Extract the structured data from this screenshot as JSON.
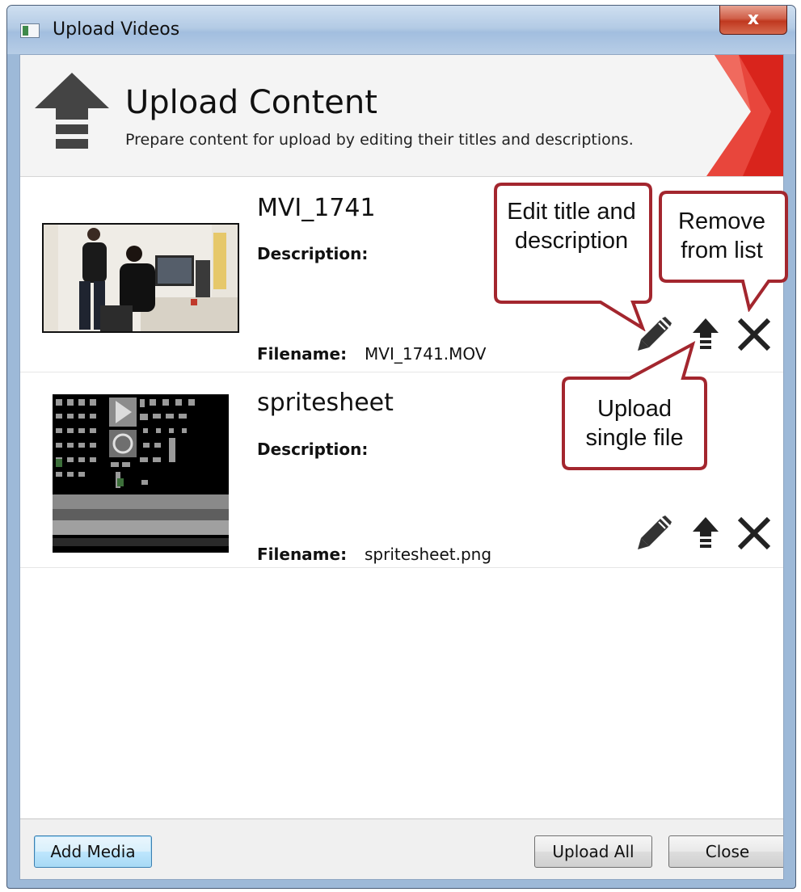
{
  "window": {
    "title": "Upload Videos",
    "close_glyph": "x"
  },
  "header": {
    "title": "Upload Content",
    "subtitle": "Prepare content for upload by editing their titles and descriptions.",
    "icon": "upload-arrow-icon",
    "accent_color": "#d9241c"
  },
  "items": [
    {
      "title": "MVI_1741",
      "description_label": "Description:",
      "description": "",
      "filename_label": "Filename:",
      "filename": "MVI_1741.MOV",
      "thumbnail": "office-photo"
    },
    {
      "title": "spritesheet",
      "description_label": "Description:",
      "description": "",
      "filename_label": "Filename:",
      "filename": "spritesheet.png",
      "thumbnail": "spritesheet-image"
    }
  ],
  "actions": {
    "edit": "pencil-icon",
    "upload": "upload-icon",
    "remove": "close-icon"
  },
  "callouts": {
    "edit": "Edit title and description",
    "remove": "Remove from list",
    "upload": "Upload single file",
    "border_color": "#a3262e"
  },
  "footer": {
    "add_media": "Add Media",
    "upload_all": "Upload All",
    "close": "Close"
  }
}
